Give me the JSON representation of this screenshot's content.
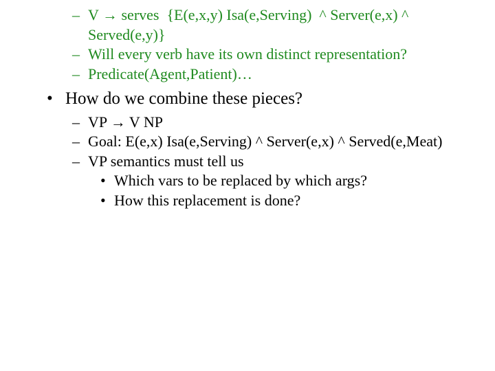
{
  "block1": {
    "items": [
      "V → serves  {E(e,x,y) Isa(e,Serving)  ^ Server(e,x) ^ Served(e,y)}",
      "Will every verb have its own distinct representation?",
      "Predicate(Agent,Patient)…"
    ]
  },
  "bullet": "How do we combine these pieces?",
  "block2": {
    "items": [
      "VP → V NP",
      "Goal: E(e,x) Isa(e,Serving) ^ Server(e,x) ^ Served(e,Meat)",
      "VP semantics must tell us"
    ],
    "subitems": [
      "Which vars to be replaced by which args?",
      "How this replacement is done?"
    ]
  },
  "arrow": "→"
}
